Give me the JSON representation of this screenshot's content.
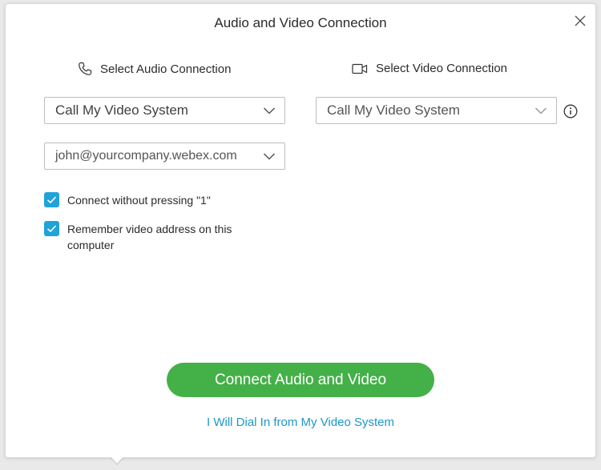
{
  "dialog": {
    "title": "Audio and Video Connection"
  },
  "audio": {
    "heading": "Select Audio Connection",
    "selected": "Call My Video System",
    "address": "john@yourcompany.webex.com"
  },
  "video": {
    "heading": "Select Video Connection",
    "selected": "Call My Video System"
  },
  "options": {
    "connect_without_pressing": "Connect without pressing \"1\"",
    "remember_address": "Remember video address on this computer"
  },
  "actions": {
    "connect": "Connect Audio and Video",
    "dial_in": "I Will Dial In from My Video System"
  },
  "icons": {
    "close": "close-icon",
    "phone": "phone-icon",
    "camera": "camera-icon",
    "chevron": "chevron-down-icon",
    "info": "info-icon",
    "check": "checkmark-icon"
  },
  "colors": {
    "primary_green": "#44b048",
    "link_blue": "#1c97c9",
    "checkbox_blue": "#1fa3d9"
  }
}
